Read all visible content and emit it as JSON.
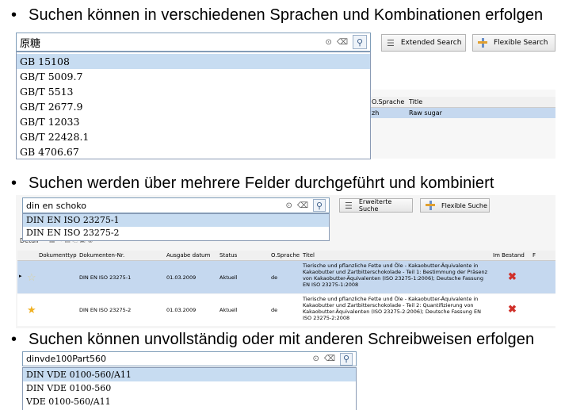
{
  "bullets": {
    "b1": "Suchen können in verschiedenen Sprachen und Kombinationen erfolgen",
    "b2": "Suchen werden über mehrere Felder durchgeführt und kombiniert",
    "b3": "Suchen können unvollständig oder mit anderen Schreibweisen erfolgen",
    "symbol": "•"
  },
  "panel1": {
    "search_value": "原糖",
    "extended_label": "Extended Search",
    "flexible_label": "Flexible Search",
    "dropdown": [
      "GB 15108",
      "GB/T 5009.7",
      "GB/T 5513",
      "GB/T 2677.9",
      "GB/T 12033",
      "GB/T 22428.1",
      "GB 4706.67"
    ],
    "grid_headers": {
      "lang": "O.Sprache",
      "title": "Title"
    },
    "row": {
      "lang": "zh",
      "title": "Raw sugar"
    }
  },
  "panel2": {
    "search_value": "din en schoko",
    "extended_label": "Erweiterte Suche",
    "flexible_label": "Flexible Suche",
    "dropdown": [
      "DIN EN ISO 23275-1",
      "DIN EN ISO 23275-2"
    ],
    "toolbar_text": "Detail",
    "headers": {
      "doctype": "Dokumenttyp",
      "docnr": "Dokumenten-Nr.",
      "date": "Ausgabe datum",
      "status": "Status",
      "lang": "O.Sprache",
      "title": "Titel",
      "stock": "Im Bestand",
      "extra": "F"
    },
    "rows": [
      {
        "docnr": "DIN EN ISO 23275-1",
        "date": "01.03.2009",
        "status": "Aktuell",
        "lang": "de",
        "title": "Tierische und pflanzliche Fette und Öle - Kakaobutter-Äquivalente in Kakaobutter und Zartbitterschokolade - Teil 1: Bestimmung der Präsenz von Kakaobutter-Äquivalenten (ISO 23275-1:2006); Deutsche Fassung EN ISO 23275-1:2008"
      },
      {
        "docnr": "DIN EN ISO 23275-2",
        "date": "01.03.2009",
        "status": "Aktuell",
        "lang": "de",
        "title": "Tierische und pflanzliche Fette und Öle - Kakaobutter-Äquivalente in Kakaobutter und Zartbitterschokolade - Teil 2: Quantifizierung von Kakaobutter-Äquivalenten (ISO 23275-2:2006); Deutsche Fassung EN ISO 23275-2:2008"
      }
    ]
  },
  "panel3": {
    "search_value": "dinvde100Part560",
    "dropdown": [
      "DIN VDE 0100-560/A11",
      "DIN VDE 0100-560",
      "VDE 0100-560/A11"
    ]
  },
  "colors": {
    "selection": "#c7dcf1",
    "row_selected": "#c5d8ef",
    "delete_red": "#d0302a",
    "star": "#f0b020"
  }
}
